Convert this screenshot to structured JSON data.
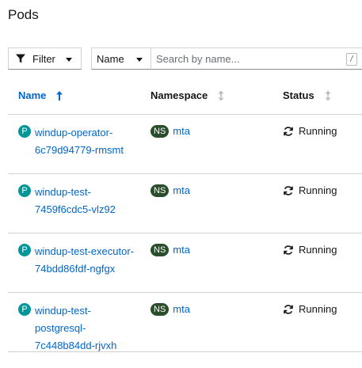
{
  "page": {
    "title": "Pods"
  },
  "toolbar": {
    "filter_label": "Filter",
    "attribute_select": "Name",
    "search_placeholder": "Search by name...",
    "search_value": "",
    "shortcut_key": "/"
  },
  "table": {
    "columns": {
      "name": "Name",
      "namespace": "Namespace",
      "status": "Status"
    },
    "sorted_by": "Name",
    "rows": [
      {
        "badge": "P",
        "name": "windup-operator-6c79d94779-rmsmt",
        "ns_badge": "NS",
        "namespace": "mta",
        "status": "Running"
      },
      {
        "badge": "P",
        "name": "windup-test-7459f6cdc5-vlz92",
        "ns_badge": "NS",
        "namespace": "mta",
        "status": "Running"
      },
      {
        "badge": "P",
        "name": "windup-test-executor-74bdd86fdf-ngfgx",
        "ns_badge": "NS",
        "namespace": "mta",
        "status": "Running"
      },
      {
        "badge": "P",
        "name": "windup-test-postgresql-7c448b84dd-rjvxh",
        "ns_badge": "NS",
        "namespace": "mta",
        "status": "Running"
      }
    ]
  },
  "colors": {
    "link": "#0066cc",
    "pod_badge": "#009596",
    "namespace_badge": "#2a4d2b",
    "border": "#d2d2d2"
  },
  "icons": {
    "filter": "filter-icon",
    "sort_asc": "sort-ascending-icon",
    "sort_none": "sort-icon",
    "status_running": "sync-icon"
  }
}
